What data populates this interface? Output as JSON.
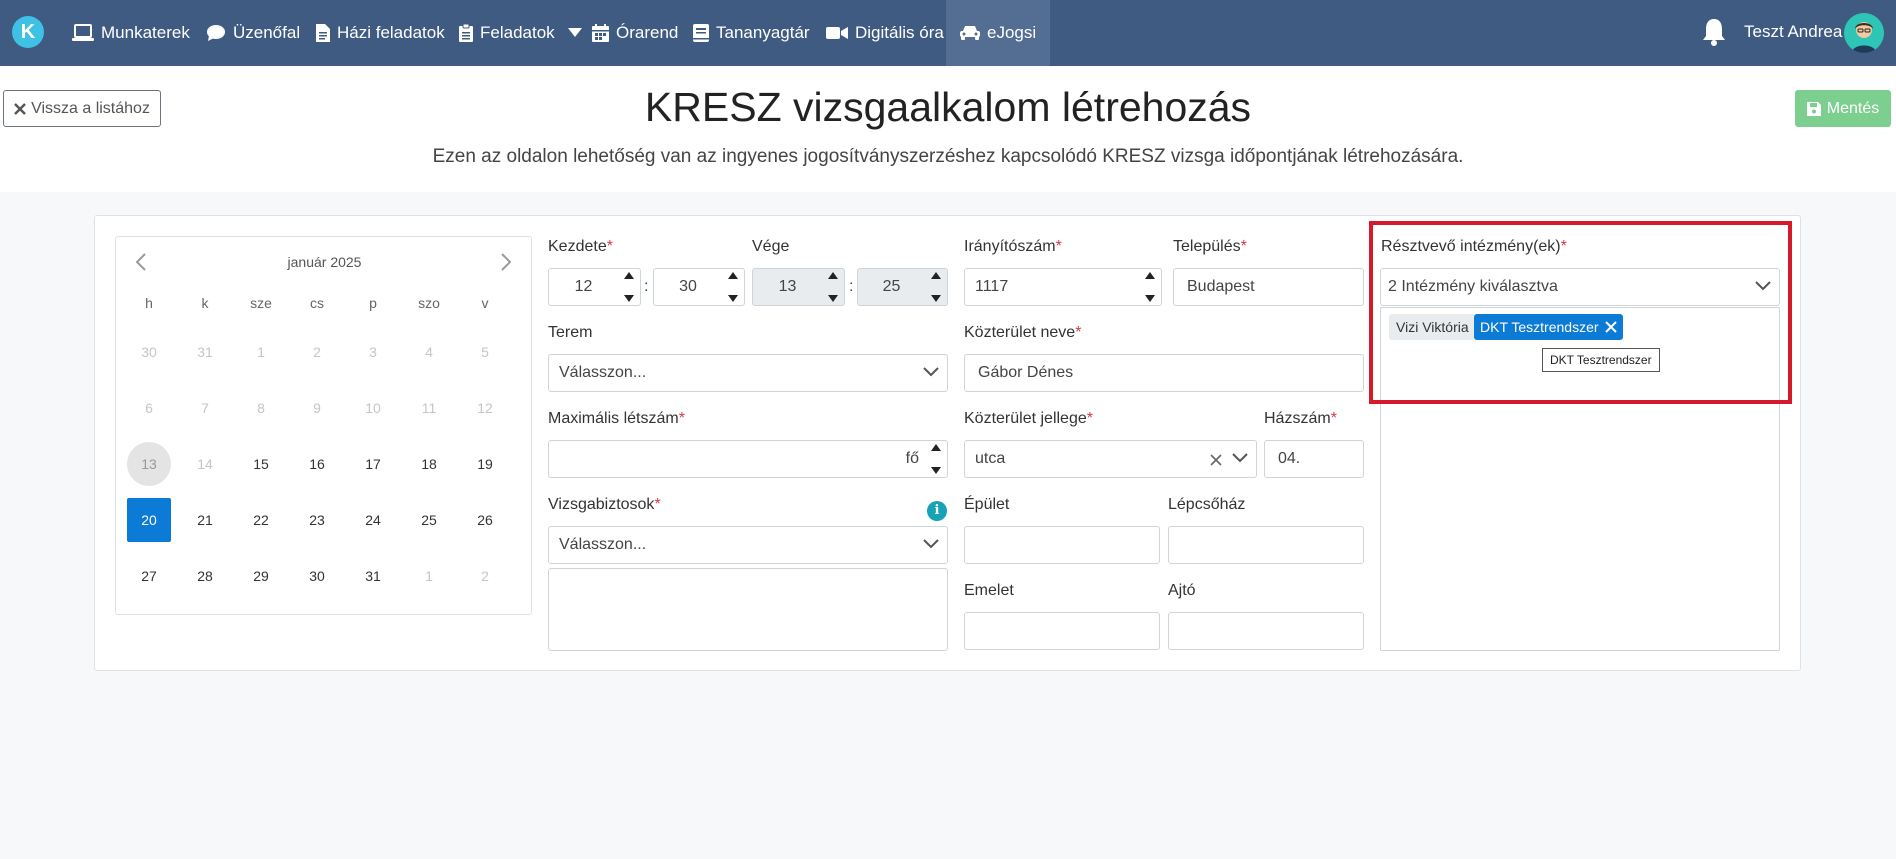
{
  "nav": {
    "items": [
      {
        "label": "Munkaterek",
        "icon": "laptop-icon"
      },
      {
        "label": "Üzenőfal",
        "icon": "chat-icon"
      },
      {
        "label": "Házi feladatok",
        "icon": "document-icon"
      },
      {
        "label": "Feladatok",
        "icon": "clipboard-icon"
      },
      {
        "label": "Órarend",
        "icon": "calendar-icon"
      },
      {
        "label": "Tananyagtár",
        "icon": "book-icon"
      },
      {
        "label": "Digitális óra",
        "icon": "video-icon"
      },
      {
        "label": "eJogsi",
        "icon": "car-icon"
      }
    ],
    "user_name": "Teszt Andrea"
  },
  "header": {
    "back_label": "Vissza a listához",
    "title": "KRESZ vizsgaalkalom létrehozás",
    "subtitle": "Ezen az oldalon lehetőség van az ingyenes jogosítványszerzéshez kapcsolódó KRESZ vizsga időpontjának létrehozására.",
    "save_label": "Mentés"
  },
  "calendar": {
    "month": "január 2025",
    "weekdays": [
      "h",
      "k",
      "sze",
      "cs",
      "p",
      "szo",
      "v"
    ],
    "weeks": [
      [
        "30",
        "31",
        "1",
        "2",
        "3",
        "4",
        "5"
      ],
      [
        "6",
        "7",
        "8",
        "9",
        "10",
        "11",
        "12"
      ],
      [
        "13",
        "14",
        "15",
        "16",
        "17",
        "18",
        "19"
      ],
      [
        "20",
        "21",
        "22",
        "23",
        "24",
        "25",
        "26"
      ],
      [
        "27",
        "28",
        "29",
        "30",
        "31",
        "1",
        "2"
      ]
    ]
  },
  "form": {
    "start_label": "Kezdete",
    "start_hour": "12",
    "start_minute": "30",
    "end_label": "Vége",
    "end_hour": "13",
    "end_minute": "25",
    "time_separator": ":",
    "room_label": "Terem",
    "room_placeholder": "Válasszon...",
    "max_label": "Maximális létszám",
    "max_unit": "fő",
    "examiners_label": "Vizsgabiztosok",
    "examiners_placeholder": "Válasszon...",
    "info_symbol": "i",
    "zip_label": "Irányítószám",
    "zip_value": "1117",
    "city_label": "Település",
    "city_value": "Budapest",
    "street_label": "Közterület neve",
    "street_value": "Gábor Dénes",
    "street_type_label": "Közterület jellege",
    "street_type_value": "utca",
    "house_label": "Házszám",
    "house_value": "04.",
    "building_label": "Épület",
    "stairs_label": "Lépcsőház",
    "floor_label": "Emelet",
    "door_label": "Ajtó",
    "required_mark": "*"
  },
  "institutions": {
    "label": "Résztvevő intézmény(ek)",
    "summary": "2 Intézmény kiválasztva",
    "tags": [
      {
        "label": "Vizi Viktória",
        "selected": false
      },
      {
        "label": "DKT Tesztrendszer",
        "selected": true
      }
    ],
    "tooltip": "DKT Tesztrendszer"
  },
  "colors": {
    "nav_bg": "#3f5b82",
    "primary": "#0b7bd6",
    "success": "#7ccf8f",
    "required": "#dc3545",
    "highlight": "#d51b2b"
  }
}
